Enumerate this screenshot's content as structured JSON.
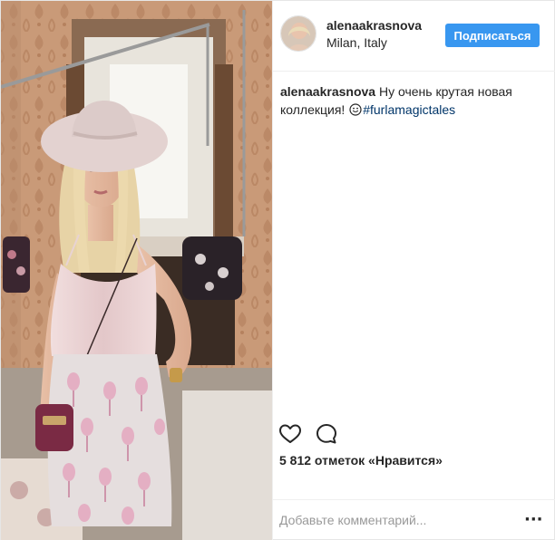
{
  "header": {
    "username": "alenaakrasnova",
    "location": "Milan, Italy",
    "follow_label": "Подписаться"
  },
  "caption": {
    "username": "alenaakrasnova",
    "text": "Ну очень крутая новая коллекция!",
    "emoji": "smiling-face",
    "hashtag": "#furlamagictales"
  },
  "actions": {
    "like_icon": "heart-outline-icon",
    "comment_icon": "comment-bubble-icon"
  },
  "likes": {
    "text": "5 812 отметок «Нравится»"
  },
  "comment_box": {
    "placeholder": "Добавьте комментарий...",
    "more_icon": "more-options-icon"
  },
  "colors": {
    "accent": "#3897f0",
    "hashtag": "#003569",
    "text": "#262626",
    "muted": "#999999"
  }
}
